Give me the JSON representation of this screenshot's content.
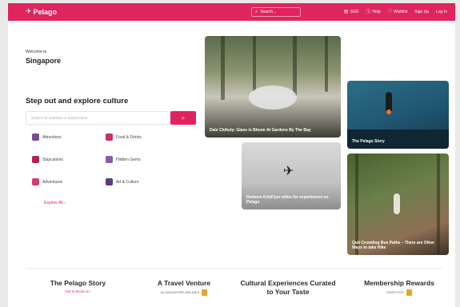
{
  "nav": {
    "brand": "Pelago",
    "search_placeholder": "Search...",
    "currency": "SGD",
    "help": "Help",
    "wishlist": "Wishlist",
    "signup": "Sign Up",
    "login": "Log In"
  },
  "hero": {
    "welcome": "Welcome to",
    "city": "Singapore",
    "headline": "Step out and explore culture",
    "search_placeholder": "Search for activities or experiences"
  },
  "categories": [
    {
      "label": "Attractions",
      "icon": "attractions-icon"
    },
    {
      "label": "Food & Drinks",
      "icon": "food-drinks-icon"
    },
    {
      "label": "Staycations",
      "icon": "staycations-icon"
    },
    {
      "label": "Hidden Gems",
      "icon": "hidden-gems-icon"
    },
    {
      "label": "Adventures",
      "icon": "adventures-icon"
    },
    {
      "label": "Art & Culture",
      "icon": "art-culture-icon"
    }
  ],
  "explore_all": "Explore All",
  "cards": {
    "card1": "Dale Chihuly: Glass in Bloom At Gardens By The Bay",
    "card2": "The Pelago Story",
    "card3": "Redeem KrisFlyer miles for experiences on Pelago",
    "card4": "Quit Crowding Bus Paths – There are Other Ways to take Hike"
  },
  "features": [
    {
      "title": "The Pelago Story",
      "sub": "Get to know us"
    },
    {
      "title": "A Travel Venture",
      "sub": "by SINGAPORE AIRLINES"
    },
    {
      "title": "Cultural Experiences Curated to Your Taste",
      "sub": ""
    },
    {
      "title": "Membership Rewards",
      "sub": "KRISFLYER"
    }
  ],
  "colors": {
    "brand": "#e0245e"
  }
}
